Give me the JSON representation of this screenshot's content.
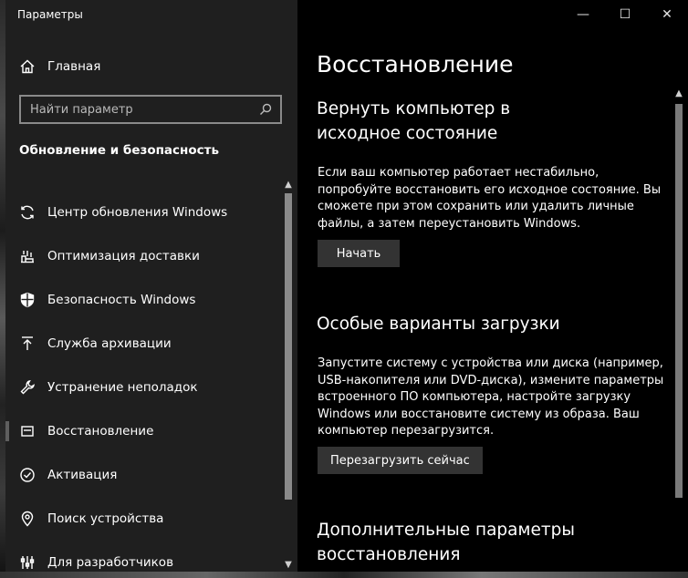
{
  "window": {
    "title": "Параметры",
    "controls": {
      "minimize": "—",
      "maximize": "☐",
      "close": "✕"
    }
  },
  "sidebar": {
    "home_label": "Главная",
    "search_placeholder": "Найти параметр",
    "section_title": "Обновление и безопасность",
    "items": [
      {
        "label": "Центр обновления Windows",
        "icon": "sync-icon"
      },
      {
        "label": "Оптимизация доставки",
        "icon": "delivery-icon"
      },
      {
        "label": "Безопасность Windows",
        "icon": "shield-icon"
      },
      {
        "label": "Служба архивации",
        "icon": "backup-icon"
      },
      {
        "label": "Устранение неполадок",
        "icon": "wrench-icon"
      },
      {
        "label": "Восстановление",
        "icon": "recovery-icon",
        "selected": true
      },
      {
        "label": "Активация",
        "icon": "check-circle-icon"
      },
      {
        "label": "Поиск устройства",
        "icon": "locate-icon"
      },
      {
        "label": "Для разработчиков",
        "icon": "developer-icon"
      }
    ]
  },
  "main": {
    "page_title": "Восстановление",
    "reset": {
      "heading": "Вернуть компьютер в исходное состояние",
      "description": "Если ваш компьютер работает нестабильно, попробуйте восстановить его исходное состояние. Вы сможете при этом сохранить или удалить личные файлы, а затем переустановить Windows.",
      "button": "Начать"
    },
    "advanced_startup": {
      "heading": "Особые варианты загрузки",
      "description": "Запустите систему с устройства или диска (например, USB-накопителя или DVD-диска), измените параметры встроенного ПО компьютера, настройте загрузку Windows или восстановите систему из образа. Ваш компьютер перезагрузится.",
      "button": "Перезагрузить сейчас"
    },
    "more_options": {
      "heading": "Дополнительные параметры восстановления"
    }
  }
}
